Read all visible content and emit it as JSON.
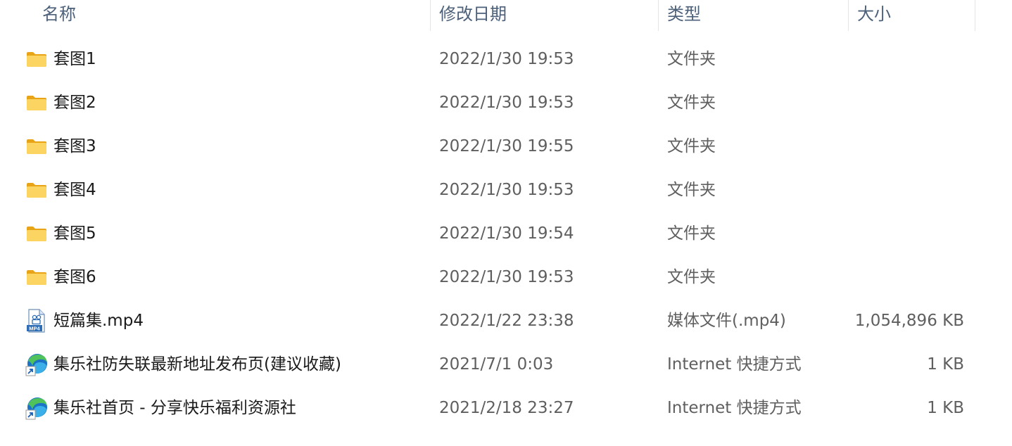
{
  "columns": {
    "name": "名称",
    "date": "修改日期",
    "type": "类型",
    "size": "大小"
  },
  "files": [
    {
      "name": "套图1",
      "date": "2022/1/30 19:53",
      "type": "文件夹",
      "size": "",
      "icon": "folder-icon"
    },
    {
      "name": "套图2",
      "date": "2022/1/30 19:53",
      "type": "文件夹",
      "size": "",
      "icon": "folder-icon"
    },
    {
      "name": "套图3",
      "date": "2022/1/30 19:55",
      "type": "文件夹",
      "size": "",
      "icon": "folder-icon"
    },
    {
      "name": "套图4",
      "date": "2022/1/30 19:53",
      "type": "文件夹",
      "size": "",
      "icon": "folder-icon"
    },
    {
      "name": "套图5",
      "date": "2022/1/30 19:54",
      "type": "文件夹",
      "size": "",
      "icon": "folder-icon"
    },
    {
      "name": "套图6",
      "date": "2022/1/30 19:53",
      "type": "文件夹",
      "size": "",
      "icon": "folder-icon"
    },
    {
      "name": "短篇集.mp4",
      "date": "2022/1/22 23:38",
      "type": "媒体文件(.mp4)",
      "size": "1,054,896 KB",
      "icon": "mp4-file-icon"
    },
    {
      "name": "集乐社防失联最新地址发布页(建议收藏)",
      "date": "2021/7/1 0:03",
      "type": "Internet 快捷方式",
      "size": "1 KB",
      "icon": "edge-shortcut-icon"
    },
    {
      "name": "集乐社首页 - 分享快乐福利资源社",
      "date": "2021/2/18 23:27",
      "type": "Internet 快捷方式",
      "size": "1 KB",
      "icon": "edge-shortcut-icon"
    }
  ],
  "colors": {
    "header_text": "#4c607a",
    "name_text": "#1a1a1a",
    "detail_text": "#5f5f5f",
    "folder_yellow": "#f8c93e",
    "edge_blue": "#1a73c7",
    "edge_green": "#4fc25b"
  }
}
